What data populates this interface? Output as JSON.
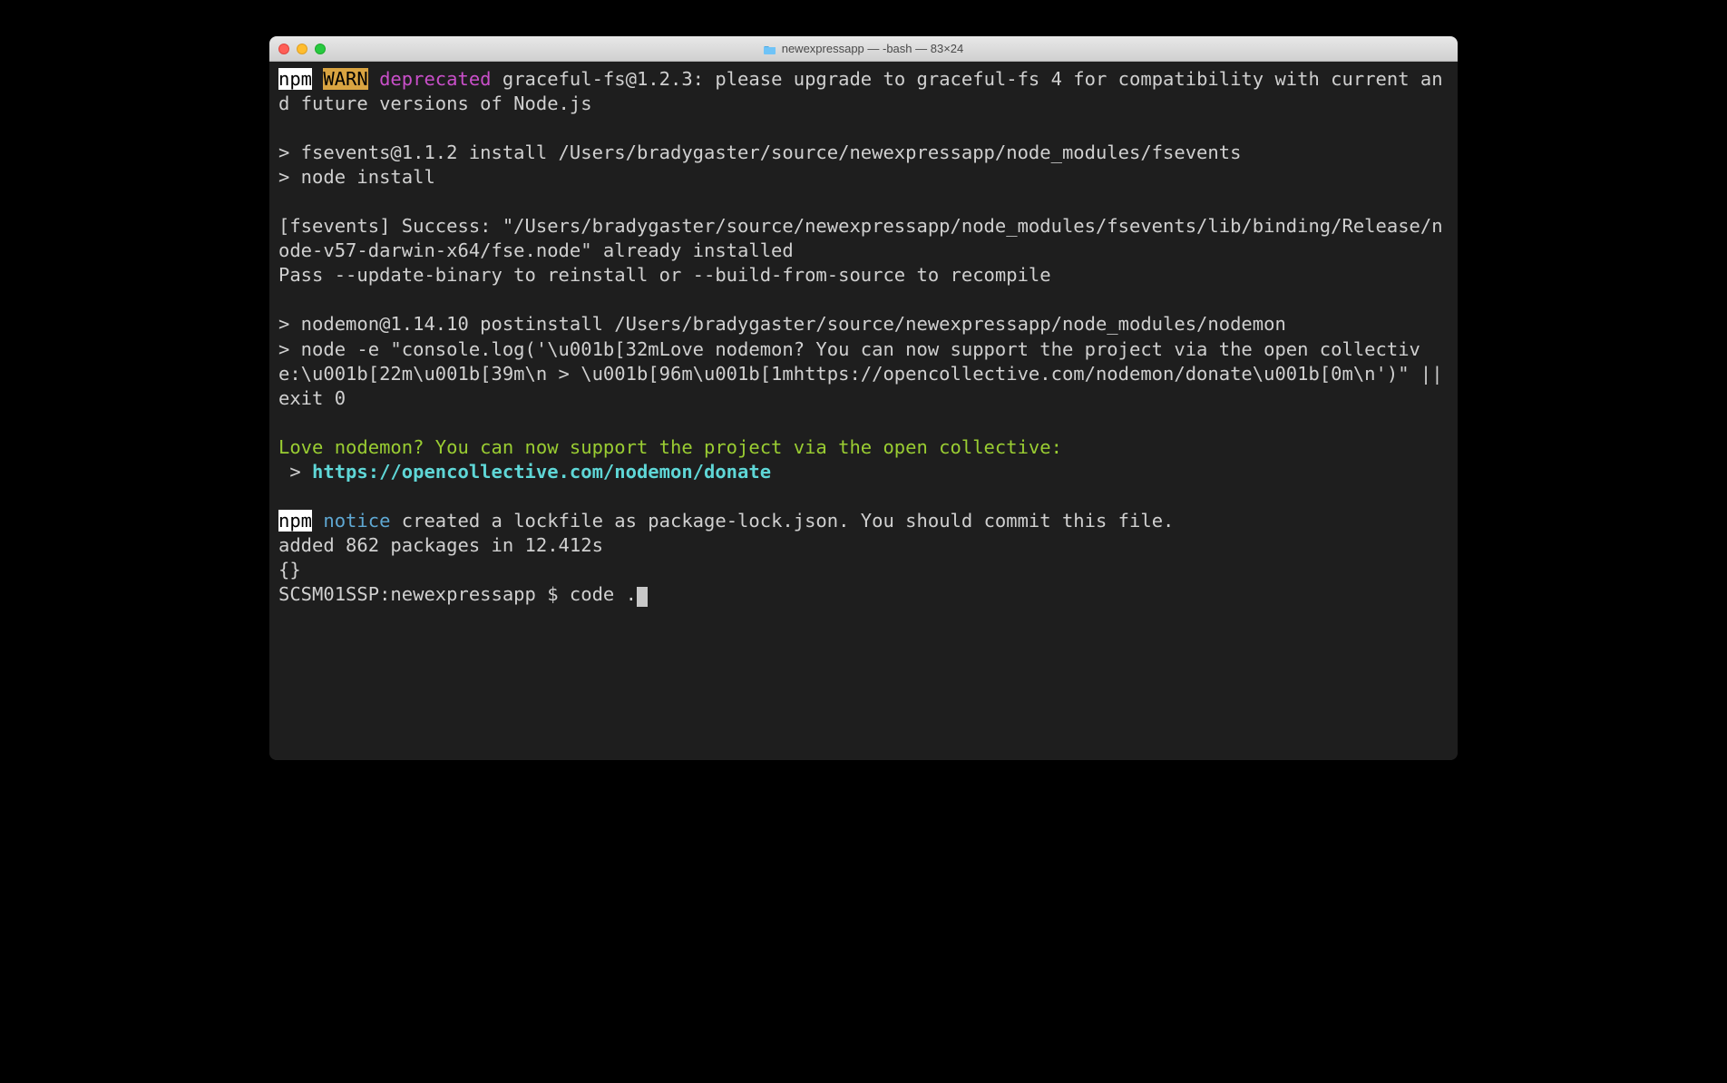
{
  "window": {
    "title": "newexpressapp — -bash — 83×24"
  },
  "term": {
    "l1_npm": "npm",
    "l1_warn": "WARN",
    "l1_dep": "deprecated",
    "l1_rest": " graceful-fs@1.2.3: please upgrade to graceful-fs 4 for compatibility with current and future versions of Node.js",
    "l3": "> fsevents@1.1.2 install /Users/bradygaster/source/newexpressapp/node_modules/fsevents",
    "l4": "> node install",
    "l6": "[fsevents] Success: \"/Users/bradygaster/source/newexpressapp/node_modules/fsevents/lib/binding/Release/node-v57-darwin-x64/fse.node\" already installed",
    "l7": "Pass --update-binary to reinstall or --build-from-source to recompile",
    "l9": "> nodemon@1.14.10 postinstall /Users/bradygaster/source/newexpressapp/node_modules/nodemon",
    "l10": "> node -e \"console.log('\\u001b[32mLove nodemon? You can now support the project via the open collective:\\u001b[22m\\u001b[39m\\n > \\u001b[96m\\u001b[1mhttps://opencollective.com/nodemon/donate\\u001b[0m\\n')\" || exit 0",
    "l12_green": "Love nodemon? You can now support the project via the open collective:",
    "l13_prefix": " > ",
    "l13_link": "https://opencollective.com/nodemon/donate",
    "l15_npm": "npm",
    "l15_notice": "notice",
    "l15_rest": " created a lockfile as package-lock.json. You should commit this file.",
    "l16": "added 862 packages in 12.412s",
    "l17": "{}",
    "prompt": "SCSM01SSP:newexpressapp $ ",
    "command": "code ."
  }
}
